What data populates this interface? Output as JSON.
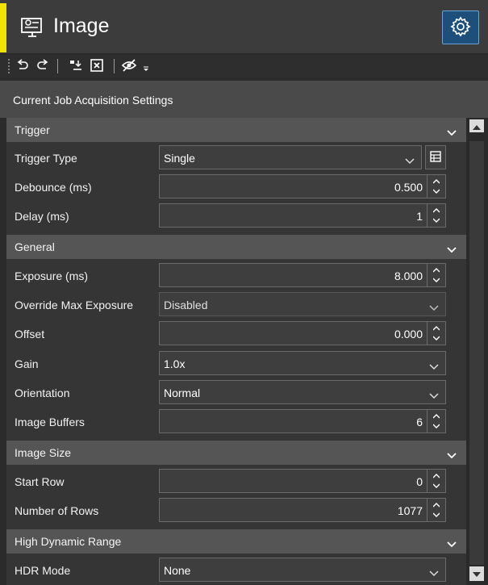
{
  "header": {
    "title": "Image",
    "accent_color": "#f2e205",
    "icon": "monitor-settings-icon",
    "settings_icon": "gear-icon"
  },
  "toolbar": {
    "icons": [
      "undo-icon",
      "redo-icon",
      "import-icon",
      "delete-box-icon",
      "hide-icon",
      "dropdown-arrow-icon"
    ]
  },
  "panel_title": "Current Job Acquisition Settings",
  "sections": {
    "trigger": {
      "label": "Trigger",
      "trigger_type": {
        "label": "Trigger Type",
        "value": "Single"
      },
      "debounce": {
        "label": "Debounce (ms)",
        "value": "0.500"
      },
      "delay": {
        "label": "Delay (ms)",
        "value": "1"
      }
    },
    "general": {
      "label": "General",
      "exposure": {
        "label": "Exposure (ms)",
        "value": "8.000"
      },
      "override_max": {
        "label": "Override Max Exposure",
        "value": "Disabled"
      },
      "offset": {
        "label": "Offset",
        "value": "0.000"
      },
      "gain": {
        "label": "Gain",
        "value": "1.0x"
      },
      "orientation": {
        "label": "Orientation",
        "value": "Normal"
      },
      "buffers": {
        "label": "Image Buffers",
        "value": "6"
      }
    },
    "image_size": {
      "label": "Image Size",
      "start_row": {
        "label": "Start Row",
        "value": "0"
      },
      "num_rows": {
        "label": "Number of Rows",
        "value": "1077"
      }
    },
    "hdr": {
      "label": "High Dynamic Range",
      "hdr_mode": {
        "label": "HDR Mode",
        "value": "None"
      }
    }
  }
}
